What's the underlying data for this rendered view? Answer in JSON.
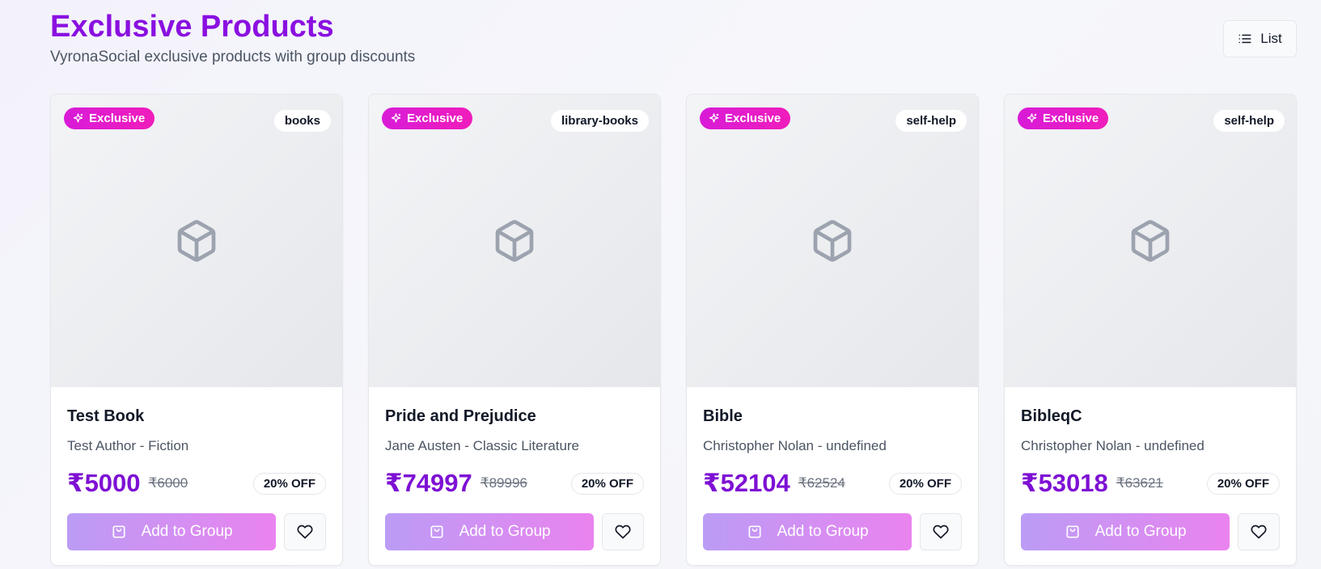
{
  "header": {
    "title": "Exclusive Products",
    "subtitle": "VyronaSocial exclusive products with group discounts"
  },
  "view_toggle": {
    "label": "List",
    "icon": "list-icon"
  },
  "colors": {
    "title": "#8a10e0",
    "price": "#7e10d4",
    "exclusive_badge_start": "#d81bd8",
    "exclusive_badge_end": "#f01dbb",
    "add_button_start": "#bb9cf5",
    "add_button_end": "#ea83ef"
  },
  "products": [
    {
      "badge": "Exclusive",
      "category": "books",
      "name": "Test Book",
      "meta": "Test Author - Fiction",
      "price": "₹5000",
      "original_price": "₹6000",
      "discount": "20% OFF",
      "add_label": "Add to Group",
      "placeholder_icon": "package-icon"
    },
    {
      "badge": "Exclusive",
      "category": "library-books",
      "name": "Pride and Prejudice",
      "meta": "Jane Austen - Classic Literature",
      "price": "₹74997",
      "original_price": "₹89996",
      "discount": "20% OFF",
      "add_label": "Add to Group",
      "placeholder_icon": "package-icon"
    },
    {
      "badge": "Exclusive",
      "category": "self-help",
      "name": "Bible",
      "meta": "Christopher Nolan - undefined",
      "price": "₹52104",
      "original_price": "₹62524",
      "discount": "20% OFF",
      "add_label": "Add to Group",
      "placeholder_icon": "package-icon"
    },
    {
      "badge": "Exclusive",
      "category": "self-help",
      "name": "BibleqC",
      "meta": "Christopher Nolan - undefined",
      "price": "₹53018",
      "original_price": "₹63621",
      "discount": "20% OFF",
      "add_label": "Add to Group",
      "placeholder_icon": "package-icon"
    }
  ]
}
